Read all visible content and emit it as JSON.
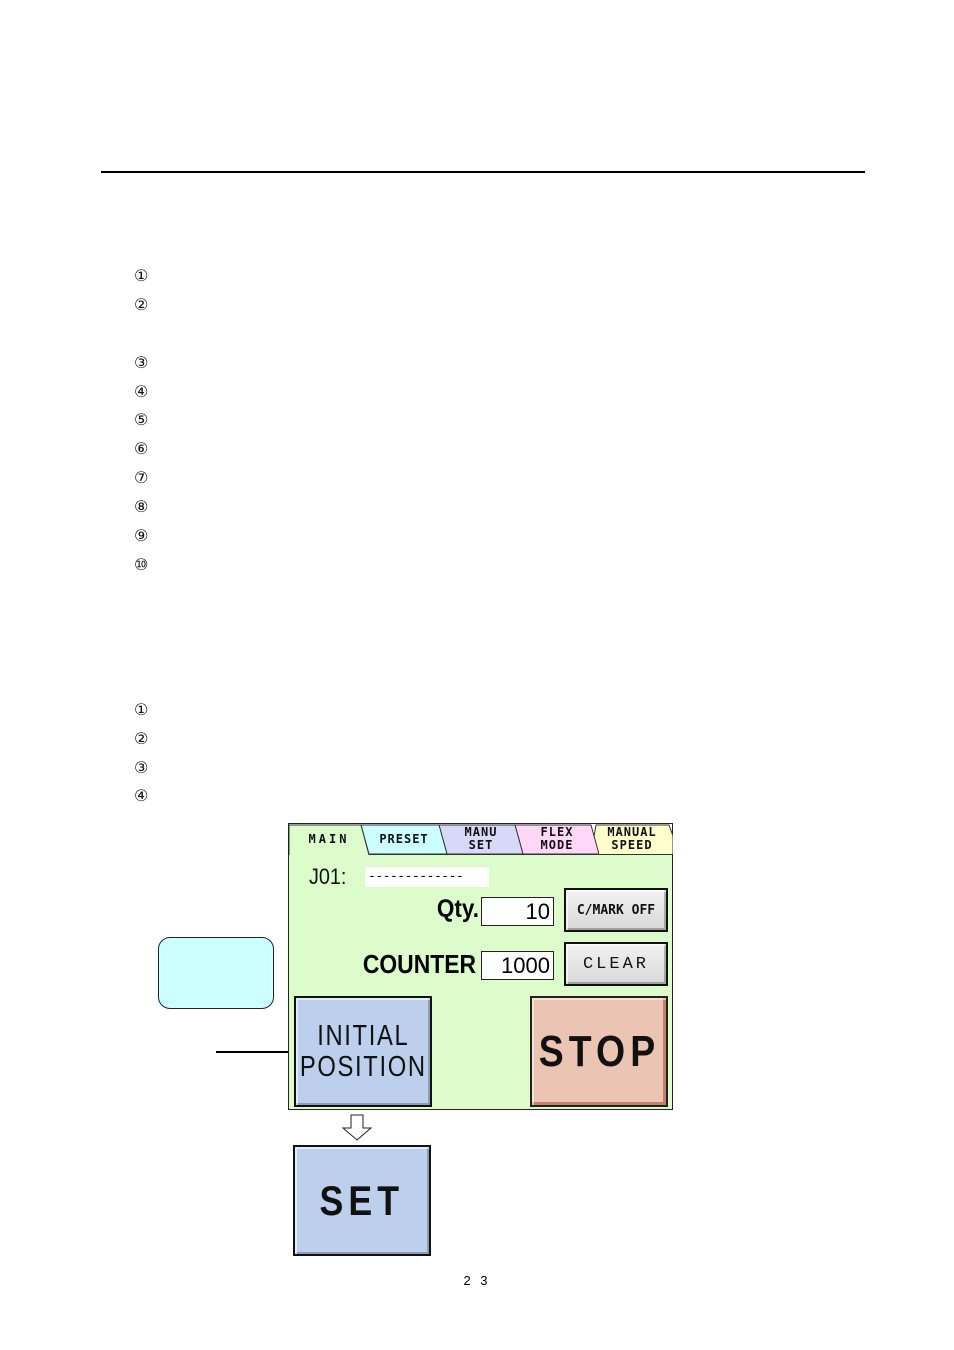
{
  "document": {
    "page_number": "2 3",
    "list_a_markers": [
      "①",
      "②",
      "③",
      "④",
      "⑤",
      "⑥",
      "⑦",
      "⑧",
      "⑨",
      "⑩"
    ],
    "list_b_markers": [
      "①",
      "②",
      "③",
      "④"
    ]
  },
  "panel": {
    "tabs": [
      {
        "label": "MAIN",
        "color": "#ddfccc"
      },
      {
        "label": "PRESET",
        "color": "#ccffff"
      },
      {
        "label": "MANU\nSET",
        "color": "#d8d8f8"
      },
      {
        "label": "FLEX\nMODE",
        "color": "#ffd8f8"
      },
      {
        "label": "MANUAL\nSPEED",
        "color": "#ffffcc"
      }
    ],
    "job": {
      "label": "J01:",
      "name": "-------------"
    },
    "qty": {
      "label": "Qty.",
      "value": "10"
    },
    "counter": {
      "label": "COUNTER",
      "value": "1000"
    },
    "buttons": {
      "cmark": "C/MARK OFF",
      "clear": "CLEAR",
      "initial_position": "INITIAL\nPOSITION",
      "stop": "STOP"
    },
    "background_color": "#ddfccc"
  },
  "result": {
    "set_button": "SET"
  },
  "colors": {
    "blue_button": "#bcd0ee",
    "stop_button": "#ecc4b4",
    "callout": "#ccffff"
  }
}
